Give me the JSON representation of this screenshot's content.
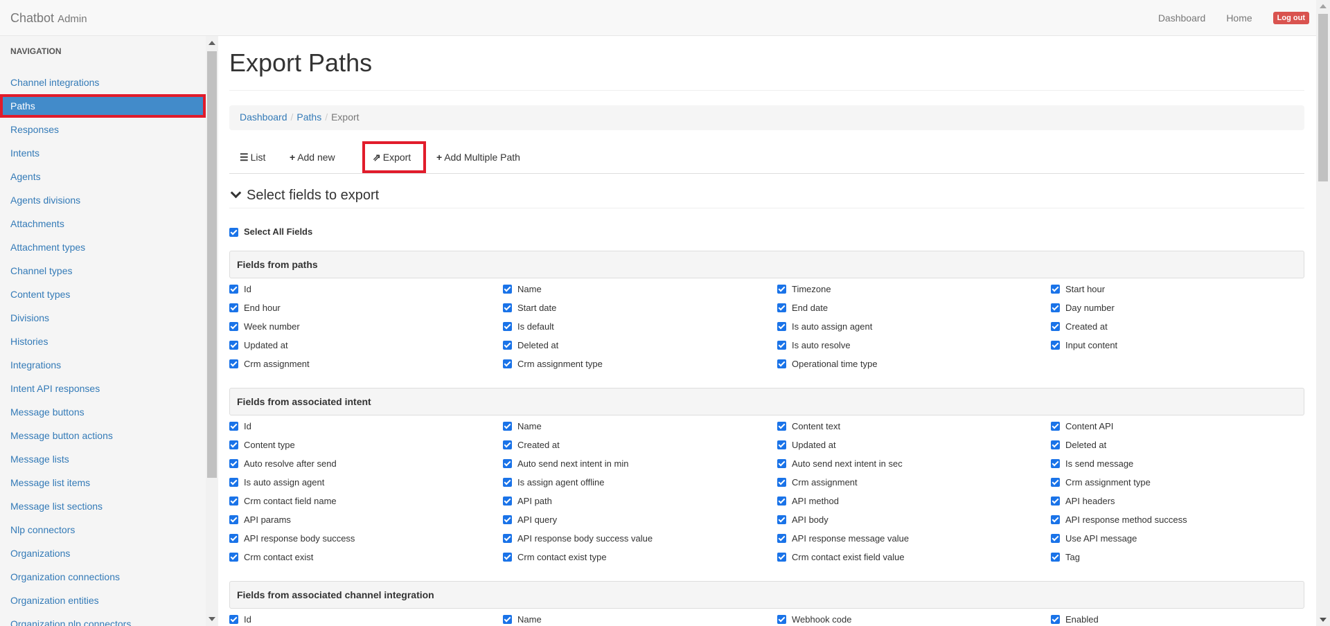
{
  "header": {
    "brand": "Chatbot",
    "brand_sub": "Admin",
    "links": [
      "Dashboard",
      "Home"
    ],
    "logout": "Log out"
  },
  "sidebar": {
    "header": "NAVIGATION",
    "items": [
      "Channel integrations",
      "Paths",
      "Responses",
      "Intents",
      "Agents",
      "Agents divisions",
      "Attachments",
      "Attachment types",
      "Channel types",
      "Content types",
      "Divisions",
      "Histories",
      "Integrations",
      "Intent API responses",
      "Message buttons",
      "Message button actions",
      "Message lists",
      "Message list items",
      "Message list sections",
      "Nlp connectors",
      "Organizations",
      "Organization connections",
      "Organization entities",
      "Organization nlp connectors"
    ],
    "active": "Paths"
  },
  "page": {
    "title": "Export Paths",
    "breadcrumb": [
      "Dashboard",
      "Paths",
      "Export"
    ],
    "tabs": [
      {
        "label": "List",
        "icon": "list-icon"
      },
      {
        "label": "Add new",
        "icon": "plus-icon"
      },
      {
        "label": "Export",
        "icon": "share-icon"
      },
      {
        "label": "Add Multiple Path",
        "icon": "plus-icon"
      }
    ],
    "active_tab": "Export",
    "section_title": "Select fields to export",
    "select_all": "Select All Fields",
    "groups": [
      {
        "title": "Fields from paths",
        "fields": [
          "Id",
          "Name",
          "Timezone",
          "Start hour",
          "End hour",
          "Start date",
          "End date",
          "Day number",
          "Week number",
          "Is default",
          "Is auto assign agent",
          "Created at",
          "Updated at",
          "Deleted at",
          "Is auto resolve",
          "Input content",
          "Crm assignment",
          "Crm assignment type",
          "Operational time type"
        ]
      },
      {
        "title": "Fields from associated intent",
        "fields": [
          "Id",
          "Name",
          "Content text",
          "Content API",
          "Content type",
          "Created at",
          "Updated at",
          "Deleted at",
          "Auto resolve after send",
          "Auto send next intent in min",
          "Auto send next intent in sec",
          "Is send message",
          "Is auto assign agent",
          "Is assign agent offline",
          "Crm assignment",
          "Crm assignment type",
          "Crm contact field name",
          "API path",
          "API method",
          "API headers",
          "API params",
          "API query",
          "API body",
          "API response method success",
          "API response body success",
          "API response body success value",
          "API response message value",
          "Use API message",
          "Crm contact exist",
          "Crm contact exist type",
          "Crm contact exist field value",
          "Tag"
        ]
      },
      {
        "title": "Fields from associated channel integration",
        "fields": [
          "Id",
          "Name",
          "Webhook code",
          "Enabled"
        ]
      }
    ]
  },
  "colors": {
    "accent": "#337ab7",
    "active_bg": "#428bca",
    "highlight": "#e11c2b",
    "checkbox": "#1a73e8",
    "logout": "#d9534f"
  }
}
